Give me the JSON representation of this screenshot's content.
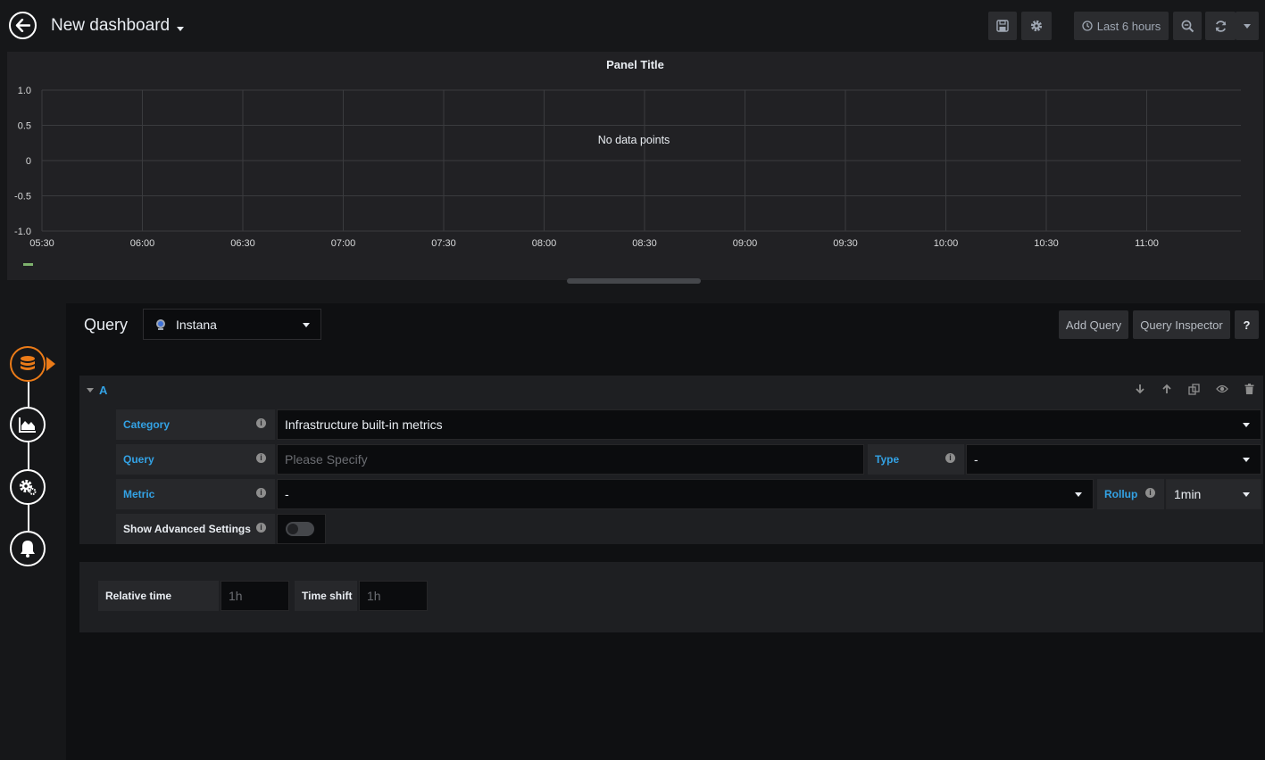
{
  "header": {
    "title": "New dashboard",
    "time_range": "Last 6 hours"
  },
  "panel": {
    "title": "Panel Title",
    "no_data": "No data points"
  },
  "chart_data": {
    "type": "line",
    "title": "Panel Title",
    "annotation": "No data points",
    "ylim": [
      -1.0,
      1.0
    ],
    "yticks": [
      "1.0",
      "0.5",
      "0",
      "-0.5",
      "-1.0"
    ],
    "xticks": [
      "05:30",
      "06:00",
      "06:30",
      "07:00",
      "07:30",
      "08:00",
      "08:30",
      "09:00",
      "09:30",
      "10:00",
      "10:30",
      "11:00"
    ],
    "series": [],
    "grid": true,
    "legend_color": "#7eb26d"
  },
  "editor": {
    "query_label": "Query",
    "datasource": "Instana",
    "add_query": "Add Query",
    "query_inspector": "Query Inspector",
    "help": "?"
  },
  "query_row": {
    "letter": "A",
    "category_label": "Category",
    "category_value": "Infrastructure built-in metrics",
    "query_label": "Query",
    "query_placeholder": "Please Specify",
    "type_label": "Type",
    "type_value": "-",
    "metric_label": "Metric",
    "metric_value": "-",
    "rollup_label": "Rollup",
    "rollup_value": "1min",
    "advanced_label": "Show Advanced Settings",
    "advanced_enabled": false
  },
  "time_options": {
    "relative_label": "Relative time",
    "relative_placeholder": "1h",
    "shift_label": "Time shift",
    "shift_placeholder": "1h"
  },
  "colors": {
    "accent_orange": "#eb7b18",
    "label_blue": "#33a2e5",
    "background": "#161719"
  }
}
